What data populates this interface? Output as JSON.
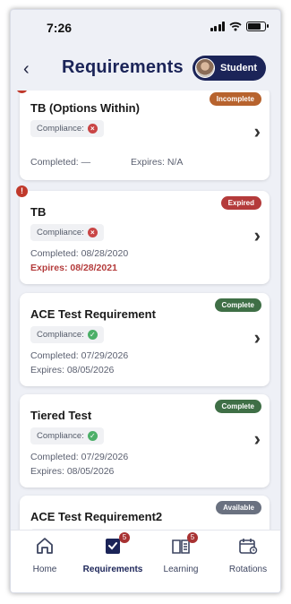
{
  "status": {
    "time": "7:26"
  },
  "header": {
    "title": "Requirements",
    "role_label": "Student"
  },
  "compliance_label": "Compliance:",
  "cards": [
    {
      "title": "TB (Options Within)",
      "badge": "Incomplete",
      "compliance": "bad",
      "completed": "Completed: —",
      "expires": "Expires: N/A",
      "alert": "!"
    },
    {
      "title": "TB",
      "badge": "Expired",
      "compliance": "bad",
      "completed": "Completed: 08/28/2020",
      "expires": "Expires: 08/28/2021",
      "alert": "!"
    },
    {
      "title": "ACE Test Requirement",
      "badge": "Complete",
      "compliance": "good",
      "completed": "Completed: 07/29/2026",
      "expires": "Expires: 08/05/2026"
    },
    {
      "title": "Tiered Test",
      "badge": "Complete",
      "compliance": "good",
      "completed": "Completed: 07/29/2026",
      "expires": "Expires: 08/05/2026"
    },
    {
      "title": "ACE Test Requirement2",
      "badge": "Available",
      "compliance": "pending"
    }
  ],
  "tabs": [
    {
      "label": "Home"
    },
    {
      "label": "Requirements",
      "badge": "5"
    },
    {
      "label": "Learning",
      "badge": "5"
    },
    {
      "label": "Rotations"
    }
  ],
  "icons": {
    "back": "chevron-left-icon",
    "chevron": "chevron-right-icon",
    "alert": "alert-icon",
    "compliance_bad": "x-circle-icon",
    "compliance_good": "check-circle-icon",
    "home": "home-icon",
    "requirements": "checklist-icon",
    "learning": "book-icon",
    "rotations": "calendar-icon"
  },
  "colors": {
    "primary": "#1b2458",
    "incomplete": "#b7632e",
    "expired": "#b43b3b",
    "complete": "#3f6f46",
    "available": "#6a7180"
  }
}
